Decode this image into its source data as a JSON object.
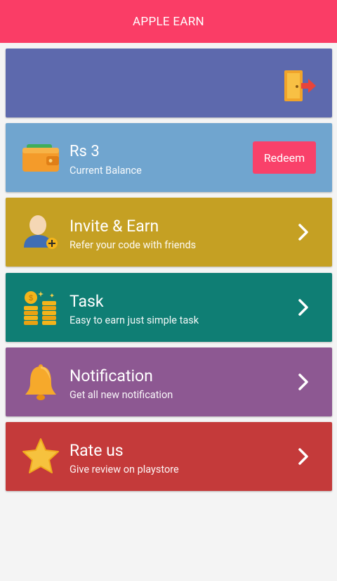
{
  "app": {
    "title": "APPLE EARN"
  },
  "colors": {
    "appbar": "#fa3d66",
    "header_card": "#5d69ad",
    "balance_card": "#70a5cf",
    "invite_card": "#c5a023",
    "task_card": "#0f7e74",
    "notification_card": "#8d5892",
    "rate_card": "#c43a3a"
  },
  "balance": {
    "amount": "Rs 3",
    "label": "Current Balance",
    "redeem_label": "Redeem"
  },
  "menu": [
    {
      "title": "Invite & Earn",
      "subtitle": "Refer your code with friends",
      "icon": "invite-user-icon"
    },
    {
      "title": "Task",
      "subtitle": "Easy to earn just simple task",
      "icon": "coins-icon"
    },
    {
      "title": "Notification",
      "subtitle": "Get all new notification",
      "icon": "bell-icon"
    },
    {
      "title": "Rate us",
      "subtitle": "Give review on playstore",
      "icon": "star-icon"
    }
  ]
}
